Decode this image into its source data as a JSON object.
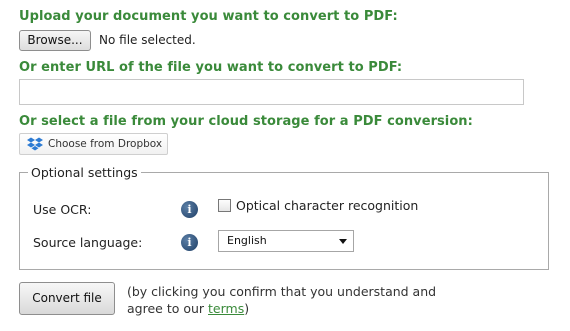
{
  "upload": {
    "heading": "Upload your document you want to convert to PDF:",
    "browse_label": "Browse...",
    "file_status": "No file selected."
  },
  "url": {
    "heading": "Or enter URL of the file you want to convert to PDF:",
    "value": "",
    "placeholder": ""
  },
  "cloud": {
    "heading": "Or select a file from your cloud storage for a PDF conversion:",
    "dropbox_label": "Choose from Dropbox",
    "dropbox_icon": "dropbox-icon",
    "dropbox_color": "#2d7bd3"
  },
  "options": {
    "legend": "Optional settings",
    "ocr_label": "Use OCR:",
    "ocr_checkbox_label": "Optical character recognition",
    "ocr_checked": false,
    "language_label": "Source language:",
    "language_value": "English",
    "info_icon_glyph": "i"
  },
  "submit": {
    "convert_label": "Convert file",
    "consent_text": "(by clicking you confirm that you understand and agree to our ",
    "terms_label": "terms",
    "consent_end": ")"
  },
  "colors": {
    "heading_green": "#3a8a3a",
    "link_green": "#3a8a3a"
  }
}
